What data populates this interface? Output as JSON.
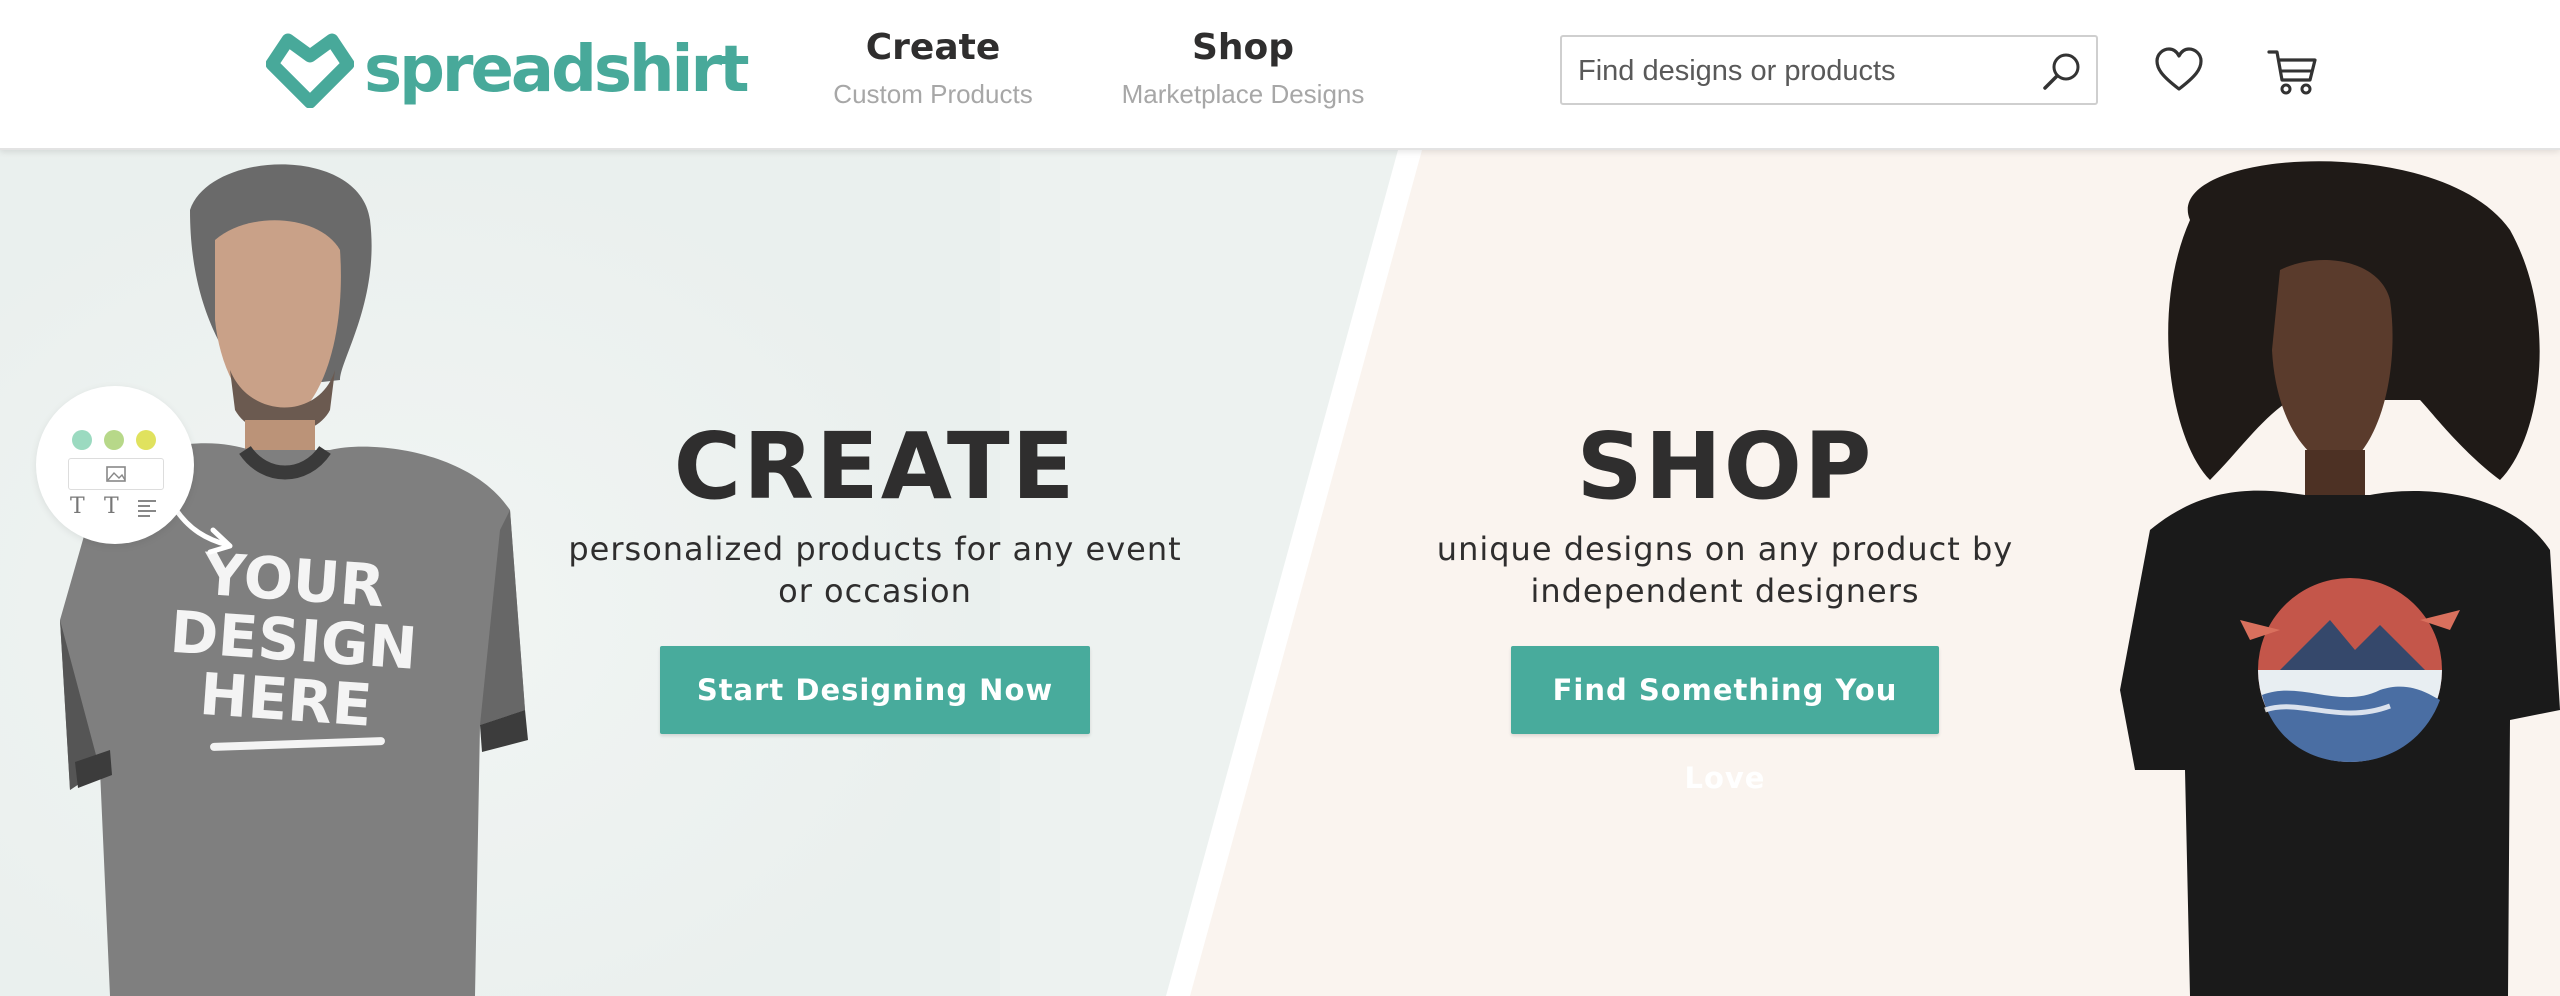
{
  "header": {
    "logo_text": "spreadshirt",
    "nav": [
      {
        "title": "Create",
        "subtitle": "Custom Products"
      },
      {
        "title": "Shop",
        "subtitle": "Marketplace Designs"
      }
    ],
    "search": {
      "placeholder": "Find designs or products",
      "value": ""
    },
    "icons": [
      "search-icon",
      "heart-icon",
      "cart-icon"
    ]
  },
  "hero": {
    "create": {
      "title": "CREATE",
      "line1": "personalized products for any event",
      "line2": "or occasion",
      "button": "Start Designing Now"
    },
    "shop": {
      "title": "SHOP",
      "line1": "unique designs on any product by",
      "line2": "independent designers",
      "button": "Find Something You Love"
    },
    "shirt_print": [
      "YOUR",
      "DESIGN",
      "HERE"
    ]
  },
  "colors": {
    "brand": "#48a99a",
    "button": "#48ab9c",
    "left_bg": "#edf2f0",
    "right_bg": "#faf4ef",
    "text": "#2f2e2e",
    "subtext": "#a7a7a7"
  }
}
